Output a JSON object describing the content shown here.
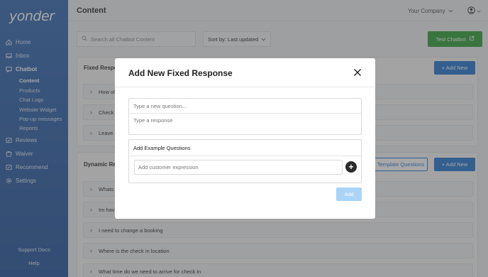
{
  "app": {
    "logo": "yonder",
    "page_title": "Content",
    "company": "Your Company"
  },
  "sidebar": {
    "items": [
      {
        "label": "Home",
        "icon": "home-icon"
      },
      {
        "label": "Inbox",
        "icon": "inbox-icon"
      },
      {
        "label": "Chatbot",
        "icon": "chatbot-icon"
      },
      {
        "label": "Reviews",
        "icon": "reviews-icon"
      },
      {
        "label": "Waiver",
        "icon": "waiver-icon"
      },
      {
        "label": "Recommend",
        "icon": "recommend-icon"
      },
      {
        "label": "Settings",
        "icon": "settings-icon"
      }
    ],
    "sub_items": [
      "Content",
      "Products",
      "Chat Logs",
      "Website Widget",
      "Pop-up messages",
      "Reports"
    ],
    "bottom": {
      "support": "Support Docs",
      "help": "Help"
    }
  },
  "toolbar": {
    "search_placeholder": "Search all Chatbot Content",
    "sort_label": "Sort by: Last updated",
    "test_button": "Test Chatbot"
  },
  "fixed_section": {
    "title": "Fixed Respo",
    "add_new": "+ Add New",
    "rows": [
      "How old",
      "Check A",
      "Leave co"
    ]
  },
  "dynamic_section": {
    "title": "Dynamic Re",
    "template_button": "Template Questions",
    "add_new": "+ Add New",
    "rows": [
      "Whats th",
      "Im havin",
      "I need to change a booking",
      "Where is the check in location",
      "What time do we need to arrive for check in"
    ]
  },
  "modal": {
    "title": "Add New Fixed Response",
    "question_placeholder": "Type a new question...",
    "response_placeholder": "Type a response",
    "example_title": "Add Example Questions",
    "expression_placeholder": "Add customer expression",
    "add_button": "Add"
  },
  "colors": {
    "sidebar": "#2c5aa0",
    "test_button": "#3aa544",
    "primary": "#2d7bd6",
    "add_disabled": "#a9d3f7"
  }
}
